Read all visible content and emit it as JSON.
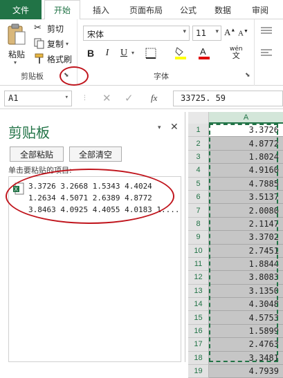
{
  "tabs": [
    "文件",
    "开始",
    "插入",
    "页面布局",
    "公式",
    "数据",
    "审阅"
  ],
  "clipboard_group": {
    "paste_label": "粘贴",
    "cut_label": "剪切",
    "copy_label": "复制",
    "format_painter_label": "格式刷",
    "group_label": "剪贴板"
  },
  "font_group": {
    "font_name": "宋体",
    "font_size": "11",
    "bold": "B",
    "italic": "I",
    "underline": "U",
    "phonetic": "wén",
    "group_label": "字体"
  },
  "formula_bar": {
    "name_box": "A1",
    "fx": "fx",
    "value": "33725. 59"
  },
  "pane": {
    "title": "剪贴板",
    "paste_all": "全部粘贴",
    "clear_all": "全部清空",
    "hint": "单击要粘贴的项目:",
    "item_lines": [
      "3.3726 3.2668 1.5343 4.4024",
      "1.2634 4.5071 2.6389 4.8772",
      "3.8463 4.0925 4.4055 4.0183 1...."
    ]
  },
  "grid": {
    "column": "A",
    "rows": [
      {
        "n": "1",
        "v": "3.3726"
      },
      {
        "n": "2",
        "v": "4.8772"
      },
      {
        "n": "3",
        "v": "1.8024"
      },
      {
        "n": "4",
        "v": "4.9160"
      },
      {
        "n": "5",
        "v": "4.7885"
      },
      {
        "n": "6",
        "v": "3.5137"
      },
      {
        "n": "7",
        "v": "2.0080"
      },
      {
        "n": "8",
        "v": "2.1147"
      },
      {
        "n": "9",
        "v": "3.3702"
      },
      {
        "n": "10",
        "v": "2.7451"
      },
      {
        "n": "11",
        "v": "1.8844"
      },
      {
        "n": "12",
        "v": "3.8083"
      },
      {
        "n": "13",
        "v": "3.1350"
      },
      {
        "n": "14",
        "v": "4.3048"
      },
      {
        "n": "15",
        "v": "4.5753"
      },
      {
        "n": "16",
        "v": "1.5899"
      },
      {
        "n": "17",
        "v": "2.4763"
      },
      {
        "n": "18",
        "v": "3.3481"
      },
      {
        "n": "19",
        "v": "4.7939"
      }
    ]
  },
  "colors": {
    "accent": "#217346",
    "annotation": "#c0141c",
    "selection": "#c6c6c6"
  }
}
